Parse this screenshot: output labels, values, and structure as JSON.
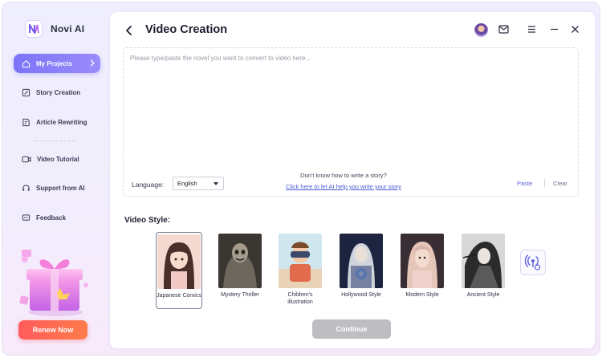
{
  "app": {
    "name": "Novi AI"
  },
  "sidebar": {
    "items": [
      {
        "label": "My Projects",
        "icon": "home-icon",
        "active": true
      },
      {
        "label": "Story Creation",
        "icon": "edit-icon"
      },
      {
        "label": "Article Rewriting",
        "icon": "document-edit-icon"
      },
      {
        "label": "Video Tutorial",
        "icon": "video-icon"
      },
      {
        "label": "Support from AI",
        "icon": "headset-icon"
      },
      {
        "label": "Feedback",
        "icon": "chat-icon"
      }
    ],
    "renew_label": "Renew Now"
  },
  "header": {
    "title": "Video Creation",
    "icons": [
      "back-icon",
      "avatar",
      "mail-icon",
      "menu-icon",
      "minimize-icon",
      "close-icon"
    ]
  },
  "editor": {
    "placeholder": "Please type/paste the novel you want to convert to video here...",
    "value": "",
    "language_label": "Language:",
    "language_value": "English",
    "help_text": "Don't know how to write a story?",
    "help_link": "Click here to let AI help you write your story",
    "paste_label": "Paste",
    "clear_label": "Clear"
  },
  "video_style": {
    "title": "Video Style:",
    "styles": [
      {
        "label": "Japanese Comics",
        "selected": true
      },
      {
        "label": "Mystery Thriller"
      },
      {
        "label": "Children's illustration"
      },
      {
        "label": "Hollywood Style"
      },
      {
        "label": "Modern Style"
      },
      {
        "label": "Ancient Style"
      }
    ],
    "extra_icon": "voice-clone-icon"
  },
  "footer": {
    "continue_label": "Continue"
  },
  "colors": {
    "accent": "#7c74f7",
    "renew": "#ff5b5b",
    "link": "#4b58d6",
    "disabled": "#bdbdc2"
  }
}
